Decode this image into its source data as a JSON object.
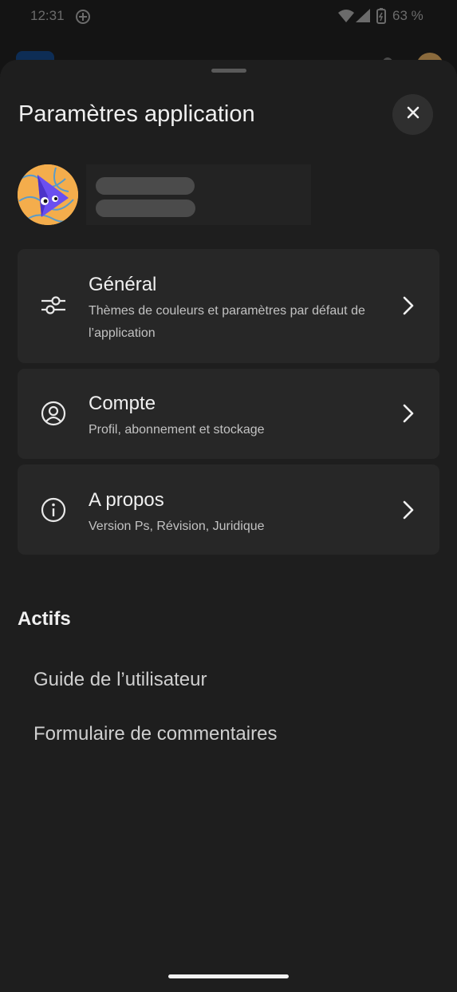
{
  "status_bar": {
    "time": "12:31",
    "battery_percent": "63 %",
    "icons": [
      "sync-icon",
      "wifi-icon",
      "signal-icon",
      "battery-icon"
    ]
  },
  "sheet": {
    "title": "Paramètres application",
    "close_icon": "close-icon"
  },
  "menu": [
    {
      "title": "Général",
      "subtitle": "Thèmes de couleurs et paramètres par défaut de l’application",
      "icon": "sliders-icon"
    },
    {
      "title": "Compte",
      "subtitle": "Profil, abonnement et stockage",
      "icon": "account-icon"
    },
    {
      "title": "A propos",
      "subtitle": "Version Ps, Révision, Juridique",
      "icon": "info-icon"
    }
  ],
  "assets": {
    "title": "Actifs",
    "links": [
      "Guide de l’utilisateur",
      "Formulaire de commentaires"
    ]
  },
  "colors": {
    "sheet_background": "#1e1e1e",
    "card_background": "#272727",
    "avatar_accent": "#f4ad4c"
  }
}
